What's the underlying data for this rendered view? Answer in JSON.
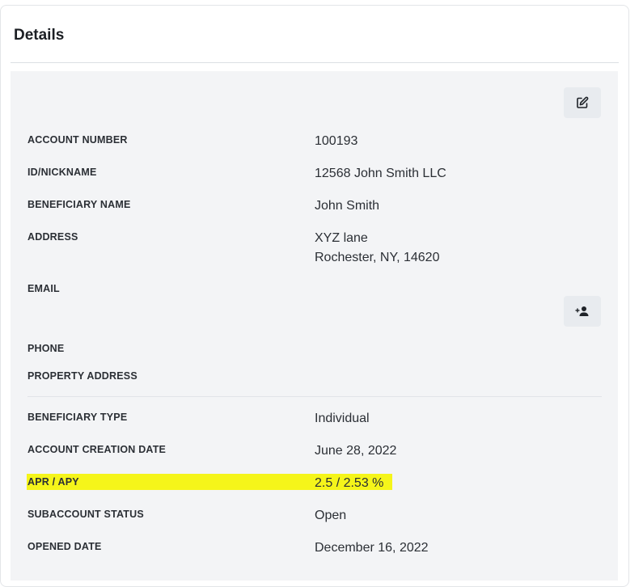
{
  "section": {
    "title": "Details"
  },
  "buttons": {
    "edit_icon": "edit-icon",
    "add_person_icon": "add-person-icon"
  },
  "fields": {
    "account_number": {
      "label": "ACCOUNT NUMBER",
      "value": "100193"
    },
    "id_nickname": {
      "label": "ID/NICKNAME",
      "value": "12568 John Smith LLC"
    },
    "beneficiary_name": {
      "label": "BENEFICIARY NAME",
      "value": "John Smith"
    },
    "address": {
      "label": "ADDRESS",
      "line1": "XYZ lane",
      "line2": "Rochester, NY, 14620"
    },
    "email": {
      "label": "EMAIL",
      "value": ""
    },
    "phone": {
      "label": "PHONE",
      "value": ""
    },
    "property_address": {
      "label": "PROPERTY ADDRESS",
      "value": ""
    },
    "beneficiary_type": {
      "label": "BENEFICIARY TYPE",
      "value": "Individual"
    },
    "account_creation_date": {
      "label": "ACCOUNT CREATION DATE",
      "value": "June 28, 2022"
    },
    "apr_apy": {
      "label": "APR / APY",
      "value": "2.5 / 2.53 %",
      "highlight_color": "#f5f51a"
    },
    "subaccount_status": {
      "label": "SUBACCOUNT STATUS",
      "value": "Open"
    },
    "opened_date": {
      "label": "OPENED DATE",
      "value": "December 16, 2022"
    }
  }
}
